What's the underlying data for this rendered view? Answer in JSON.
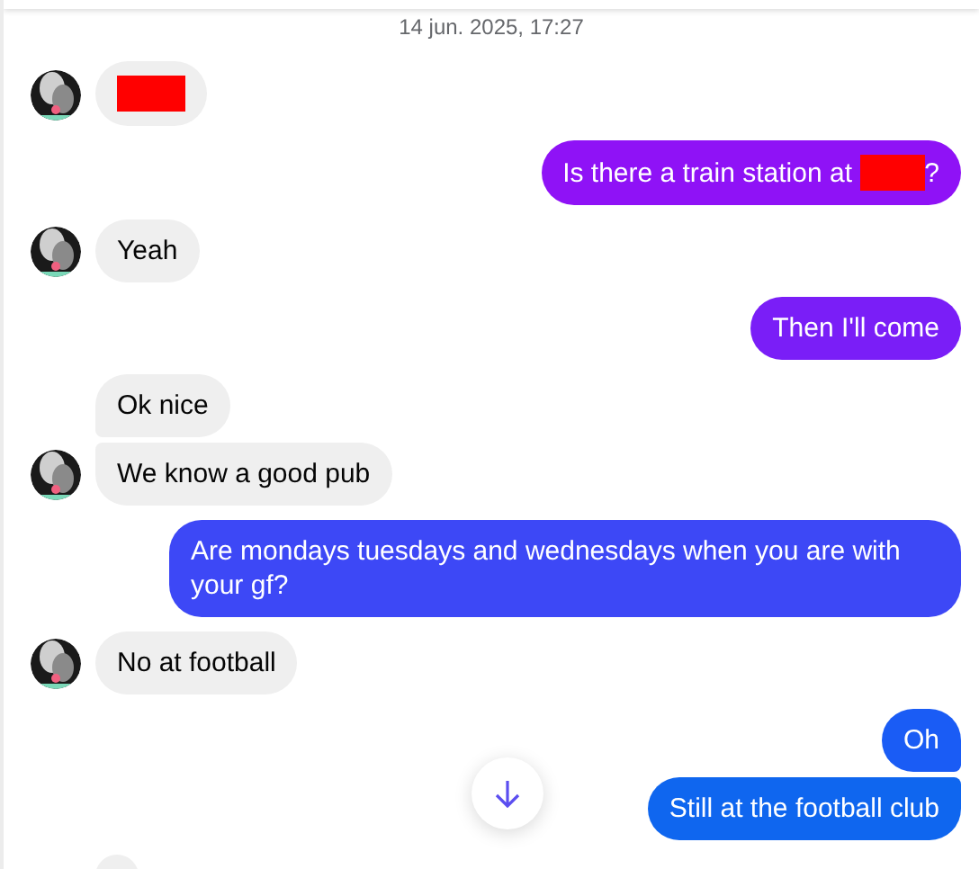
{
  "timestamp": "14 jun. 2025, 17:27",
  "messages": [
    {
      "kind": "incoming",
      "avatar": true,
      "grouped": false,
      "parts": [
        {
          "kind": "redaction"
        }
      ]
    },
    {
      "kind": "outgoing",
      "grouped": false,
      "color": "#8f12f6",
      "parts": [
        {
          "kind": "text",
          "text": "Is there a train station at "
        },
        {
          "kind": "redaction"
        },
        {
          "kind": "text",
          "text": "?"
        }
      ]
    },
    {
      "kind": "incoming",
      "avatar": true,
      "grouped": false,
      "parts": [
        {
          "kind": "text",
          "text": "Yeah"
        }
      ]
    },
    {
      "kind": "outgoing",
      "grouped": false,
      "color": "#7a1ef7",
      "parts": [
        {
          "kind": "text",
          "text": "Then I'll come"
        }
      ]
    },
    {
      "kind": "incoming",
      "avatar": false,
      "grouped": false,
      "parts": [
        {
          "kind": "text",
          "text": "Ok nice"
        }
      ]
    },
    {
      "kind": "incoming",
      "avatar": true,
      "grouped": true,
      "parts": [
        {
          "kind": "text",
          "text": "We know a good pub"
        }
      ]
    },
    {
      "kind": "outgoing",
      "grouped": false,
      "color": "#3d48f6",
      "parts": [
        {
          "kind": "text",
          "text": "Are mondays tuesdays and wednesdays when you are with your gf?"
        }
      ]
    },
    {
      "kind": "incoming",
      "avatar": true,
      "grouped": false,
      "parts": [
        {
          "kind": "text",
          "text": "No at football"
        }
      ]
    },
    {
      "kind": "outgoing",
      "grouped": false,
      "color": "#1a5cf5",
      "parts": [
        {
          "kind": "text",
          "text": "Oh"
        }
      ]
    },
    {
      "kind": "outgoing",
      "grouped": true,
      "color": "#0f66ef",
      "parts": [
        {
          "kind": "text",
          "text": "Still at the football club"
        }
      ]
    },
    {
      "kind": "incoming",
      "avatar": false,
      "grouped": false
    }
  ]
}
